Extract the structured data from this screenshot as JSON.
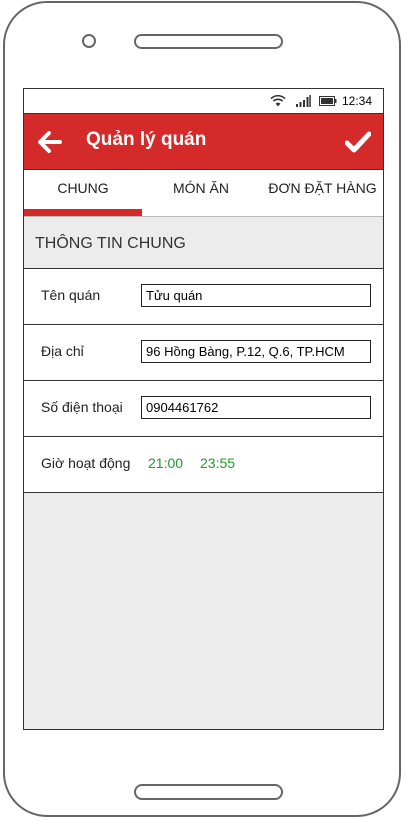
{
  "status_bar": {
    "time": "12:34"
  },
  "app_bar": {
    "title": "Quản lý quán"
  },
  "tabs": [
    {
      "label": "CHUNG",
      "active": true
    },
    {
      "label": "MÓN ĂN",
      "active": false
    },
    {
      "label": "ĐƠN ĐẶT HÀNG",
      "active": false
    }
  ],
  "section": {
    "title": "THÔNG TIN CHUNG"
  },
  "fields": {
    "name": {
      "label": "Tên quán",
      "value": "Tửu quán"
    },
    "address": {
      "label": "Địa chỉ",
      "value": "96 Hồng Bàng, P.12, Q.6, TP.HCM"
    },
    "phone": {
      "label": "Số điện thoại",
      "value": "0904461762"
    },
    "hours": {
      "label": "Giờ hoạt động",
      "open": "21:00",
      "close": "23:55"
    }
  },
  "colors": {
    "accent": "#d52a2a",
    "time_text": "#1f9b2c",
    "background": "#ececec"
  }
}
